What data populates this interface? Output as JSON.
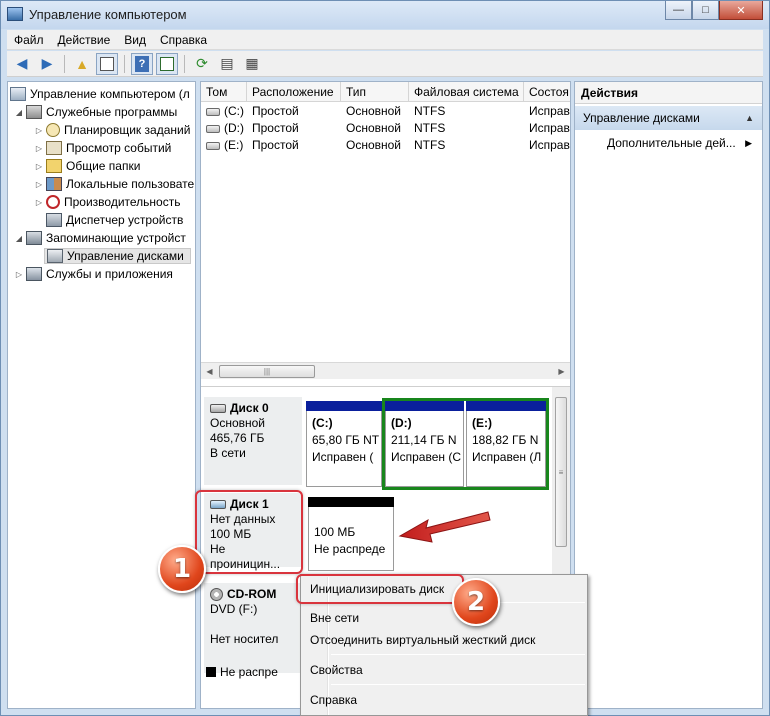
{
  "window": {
    "title": "Управление компьютером",
    "controls": {
      "minimize": "—",
      "maximize": "□",
      "close": "✕"
    }
  },
  "menu": [
    "Файл",
    "Действие",
    "Вид",
    "Справка"
  ],
  "toolbar": [
    "back-icon",
    "forward-icon",
    "up-folder-icon",
    "show-tree-icon",
    "help-icon",
    "show-action-pane-icon",
    "refresh-icon",
    "export-icon",
    "properties-icon"
  ],
  "tree": {
    "root": "Управление компьютером (л",
    "tools": "Служебные программы",
    "scheduler": "Планировщик заданий",
    "eventviewer": "Просмотр событий",
    "shared": "Общие папки",
    "localusers": "Локальные пользовате",
    "performance": "Производительность",
    "devicemgr": "Диспетчер устройств",
    "storage": "Запоминающие устройст",
    "diskmgmt": "Управление дисками",
    "services": "Службы и приложения"
  },
  "volumes": {
    "headers": [
      "Том",
      "Расположение",
      "Тип",
      "Файловая система",
      "Состоя"
    ],
    "rows": [
      [
        "(C:)",
        "Простой",
        "Основной",
        "NTFS",
        "Исправ"
      ],
      [
        "(D:)",
        "Простой",
        "Основной",
        "NTFS",
        "Исправ"
      ],
      [
        "(E:)",
        "Простой",
        "Основной",
        "NTFS",
        "Исправ"
      ]
    ]
  },
  "disks": {
    "disk0": {
      "name": "Диск 0",
      "type": "Основной",
      "size": "465,76 ГБ",
      "status": "В сети"
    },
    "disk1": {
      "name": "Диск 1",
      "type": "Нет данных",
      "size": "100 МБ",
      "status": "Не проиницин..."
    },
    "cdrom": {
      "name": "CD-ROM",
      "drive": "DVD (F:)",
      "media": "Нет носител"
    }
  },
  "partitions": {
    "c": {
      "name": "(C:)",
      "size": "65,80 ГБ NT",
      "status": "Исправен ("
    },
    "d": {
      "name": "(D:)",
      "size": "211,14 ГБ N",
      "status": "Исправен (С"
    },
    "e": {
      "name": "(E:)",
      "size": "188,82 ГБ N",
      "status": "Исправен (Л"
    },
    "unalloc": {
      "size": "100 МБ",
      "status": "Не распреде"
    }
  },
  "legend": {
    "unallocated": "Не распре"
  },
  "actions": {
    "header": "Действия",
    "section": "Управление дисками",
    "more": "Дополнительные дей..."
  },
  "context_menu": {
    "init": "Инициализировать диск",
    "offline": "Вне сети",
    "detach": "Отсоединить виртуальный жесткий диск",
    "properties": "Свойства",
    "help": "Справка"
  },
  "badges": {
    "one": "1",
    "two": "2"
  },
  "colors": {
    "primary_partition": "#0a1f9c",
    "unallocated": "#000000",
    "selection": "#18861c",
    "annotation": "#d9343d"
  }
}
